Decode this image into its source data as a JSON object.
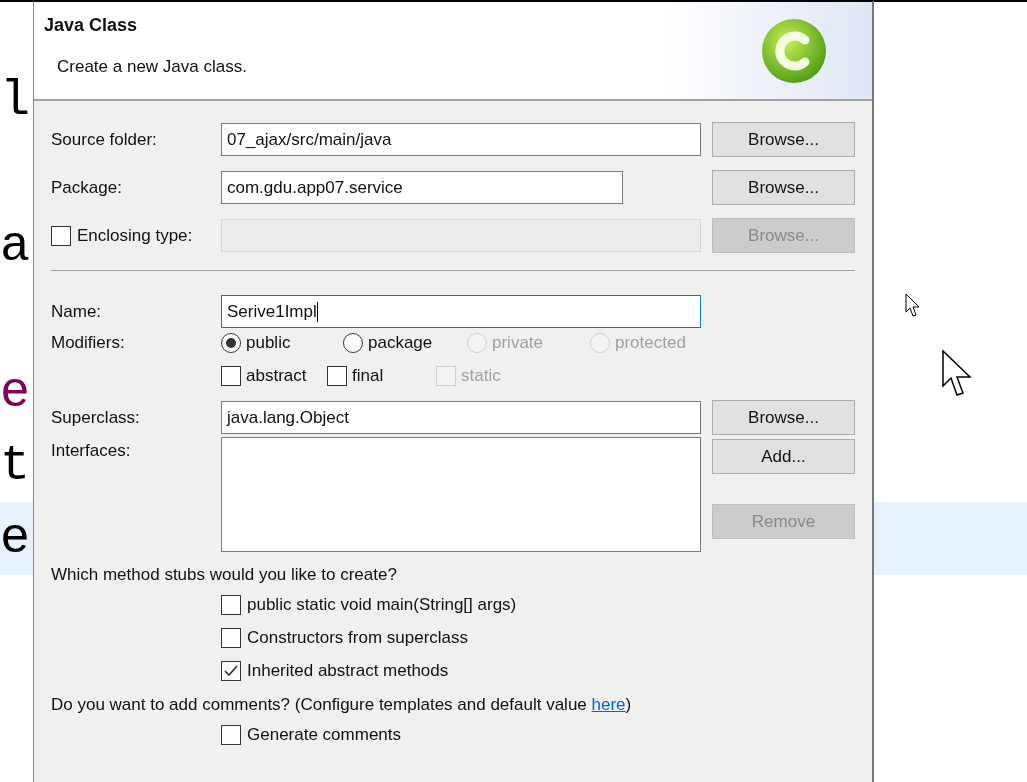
{
  "editor": {
    "lines": [
      {
        "kind": "code",
        "text": "l",
        "color": "#000000",
        "current": false
      },
      {
        "kind": "blank"
      },
      {
        "kind": "code",
        "text": "a",
        "color": "#000000",
        "current": false
      },
      {
        "kind": "blank"
      },
      {
        "kind": "code",
        "text": "e",
        "color": "#7f0055",
        "current": false
      },
      {
        "kind": "code",
        "text": "t",
        "color": "#000000",
        "current": false
      },
      {
        "kind": "code",
        "text": "e",
        "color": "#000000",
        "current": true
      }
    ]
  },
  "dialog": {
    "title": "Java Class",
    "description": "Create a new Java class.",
    "source_folder": {
      "label": "Source folder:",
      "value": "07_ajax/src/main/java",
      "button": {
        "label": "Browse...",
        "disabled": false
      }
    },
    "package": {
      "label": "Package:",
      "value": "com.gdu.app07.service",
      "button": {
        "label": "Browse...",
        "disabled": false
      }
    },
    "enclosing_type": {
      "label": "Enclosing type:",
      "checked": false,
      "disabled": true,
      "button": {
        "label": "Browse...",
        "disabled": true
      }
    },
    "name": {
      "label": "Name:",
      "value": "Serive1Impl",
      "focused": true
    },
    "modifiers": {
      "label": "Modifiers:",
      "options": [
        {
          "label": "public",
          "selected": true,
          "disabled": false
        },
        {
          "label": "package",
          "selected": false,
          "disabled": false
        },
        {
          "label": "private",
          "selected": false,
          "disabled": true
        },
        {
          "label": "protected",
          "selected": false,
          "disabled": true
        }
      ],
      "flags": [
        {
          "label": "abstract",
          "checked": false,
          "disabled": false
        },
        {
          "label": "final",
          "checked": false,
          "disabled": false
        },
        {
          "label": "static",
          "checked": false,
          "disabled": true
        }
      ]
    },
    "superclass": {
      "label": "Superclass:",
      "value": "java.lang.Object",
      "button": {
        "label": "Browse...",
        "disabled": false
      }
    },
    "interfaces": {
      "label": "Interfaces:",
      "buttons": [
        {
          "label": "Add...",
          "disabled": false
        },
        {
          "label": "Remove",
          "disabled": true
        }
      ]
    },
    "stubs": {
      "question": "Which method stubs would you like to create?",
      "options": [
        {
          "label": "public static void main(String[] args)",
          "checked": false
        },
        {
          "label": "Constructors from superclass",
          "checked": false
        },
        {
          "label": "Inherited abstract methods",
          "checked": true
        }
      ]
    },
    "comments": {
      "question_before": "Do you want to add comments? (Configure templates and default value ",
      "link": "here",
      "question_after": ")",
      "option": {
        "label": "Generate comments",
        "checked": false
      }
    }
  }
}
